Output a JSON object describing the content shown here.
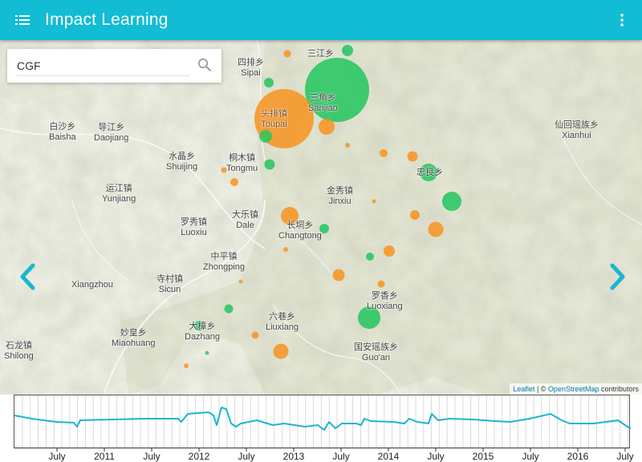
{
  "app": {
    "title": "Impact Learning"
  },
  "search": {
    "value": "CGF",
    "placeholder": ""
  },
  "icons": {
    "menu": "list-icon",
    "more": "more-vert-icon",
    "search": "search-icon",
    "prev": "chevron-left-icon",
    "next": "chevron-right-icon"
  },
  "colors": {
    "brand": "#12bcd4",
    "green": "#22c55e",
    "orange": "#f7931e",
    "accent": "#1bb6cf"
  },
  "map": {
    "labels": [
      {
        "cn": "四排乡",
        "en": "Sipai"
      },
      {
        "cn": "三江乡",
        "en": ""
      },
      {
        "cn": "三角乡",
        "en": "Sanjiao"
      },
      {
        "cn": "头排镇",
        "en": "Toupai"
      },
      {
        "cn": "白沙乡",
        "en": "Baisha"
      },
      {
        "cn": "导江乡",
        "en": "Daojiang"
      },
      {
        "cn": "仙回瑶族乡",
        "en": "Xianhui"
      },
      {
        "cn": "水晶乡",
        "en": "Shuijing"
      },
      {
        "cn": "桐木镇",
        "en": "Tongmu"
      },
      {
        "cn": "忠良乡",
        "en": ""
      },
      {
        "cn": "运江镇",
        "en": "Yunjiang"
      },
      {
        "cn": "金秀镇",
        "en": "Jinxiu"
      },
      {
        "cn": "罗秀镇",
        "en": "Luoxiu"
      },
      {
        "cn": "大乐镇",
        "en": "Dale"
      },
      {
        "cn": "长垌乡",
        "en": "Changtong"
      },
      {
        "cn": "中平镇",
        "en": "Zhongping"
      },
      {
        "cn": "",
        "en": "Xiangzhou"
      },
      {
        "cn": "寺村镇",
        "en": "Sicun"
      },
      {
        "cn": "罗香乡",
        "en": "Luoxiang"
      },
      {
        "cn": "大樟乡",
        "en": "Dazhang"
      },
      {
        "cn": "六巷乡",
        "en": "Liuxiang"
      },
      {
        "cn": "妙皇乡",
        "en": "Miaohuang"
      },
      {
        "cn": "石龙镇",
        "en": "Shilong"
      },
      {
        "cn": "国安瑶族乡",
        "en": "Guo'an"
      }
    ]
  },
  "attribution": {
    "leaflet": "Leaflet",
    "sep": " | © ",
    "osm": "OpenStreetMap",
    "suffix": " contributors"
  },
  "timeline": {
    "ticks": [
      "July",
      "2011",
      "July",
      "2012",
      "July",
      "2013",
      "July",
      "2014",
      "July",
      "2015",
      "July",
      "2016",
      "July"
    ]
  }
}
